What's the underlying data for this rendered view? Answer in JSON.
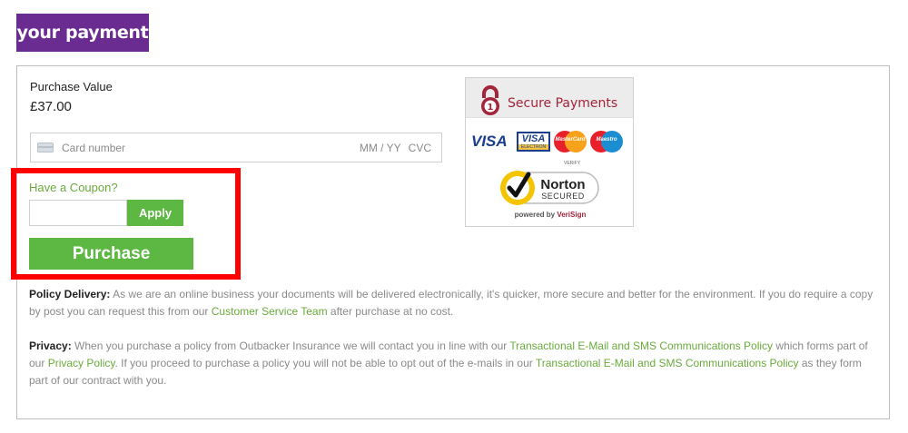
{
  "header": {
    "title": "your payment"
  },
  "purchase": {
    "label": "Purchase Value",
    "value": "£37.00"
  },
  "card": {
    "placeholder": "Card number",
    "expiry_placeholder": "MM / YY",
    "cvc_placeholder": "CVC",
    "icon": "credit-card-icon"
  },
  "coupon": {
    "label": "Have a Coupon?",
    "input_value": "",
    "apply_label": "Apply"
  },
  "purchase_button": {
    "label": "Purchase"
  },
  "secure": {
    "title": "Secure Payments",
    "card_brands": [
      "VISA",
      "VISA ELECTRON",
      "MasterCard",
      "Maestro"
    ],
    "visa": "VISA",
    "visa_electron_main": "VISA",
    "visa_electron_sub": "ELECTRON",
    "mastercard": "MasterCard",
    "maestro": "Maestro",
    "verify": "VERIFY",
    "norton_name": "Norton",
    "norton_sub": "SECURED",
    "powered_by": "powered by",
    "verisign": "VeriSign"
  },
  "policy_delivery": {
    "heading": "Policy Delivery:",
    "text1": " As we are an online business your documents will be delivered electronically, it's quicker, more secure and better for the environment. If you do require a copy by post you can request this from our ",
    "link1": "Customer Service Team",
    "text2": " after purchase at no cost."
  },
  "privacy": {
    "heading": "Privacy:",
    "text1": " When you purchase a policy from Outbacker Insurance we will contact you in line with our ",
    "link1": "Transactional E-Mail and SMS Communications Policy",
    "text2": " which forms part of our ",
    "link2": "Privacy Policy",
    "text3": ". If you proceed to purchase a policy you will not be able to opt out of the e-mails in our ",
    "link3": "Transactional E-Mail and SMS Communications Policy",
    "text4": " as they form part of our contract with you."
  },
  "colors": {
    "brand_purple": "#6a2c91",
    "accent_green": "#5db843",
    "link_green": "#6aaa3b",
    "highlight_red": "#ff0000",
    "secure_red": "#a3243b"
  }
}
